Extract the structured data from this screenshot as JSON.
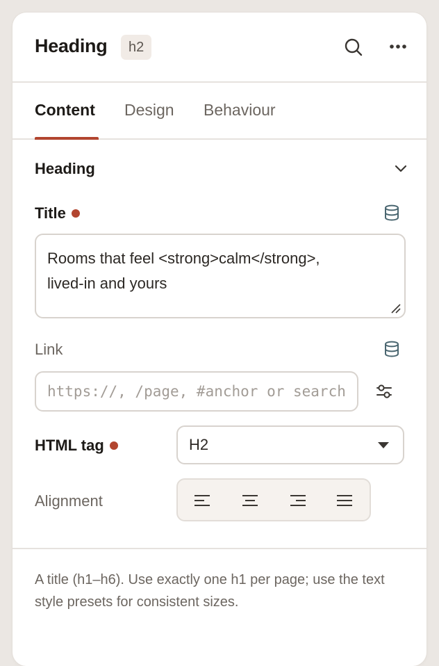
{
  "header": {
    "title": "Heading",
    "tag_badge": "h2",
    "search_icon": "search-icon",
    "more_icon": "more-horizontal-icon"
  },
  "tabs": [
    {
      "label": "Content",
      "active": true
    },
    {
      "label": "Design",
      "active": false
    },
    {
      "label": "Behaviour",
      "active": false
    }
  ],
  "section": {
    "title": "Heading",
    "collapse_icon": "chevron-down-icon"
  },
  "fields": {
    "title": {
      "label": "Title",
      "required": true,
      "value": "Rooms that feel <strong>calm</strong>,\nlived-in and yours",
      "dynamic_icon": "database-icon"
    },
    "link": {
      "label": "Link",
      "placeholder": "https://, /page, #anchor or search",
      "value": "",
      "dynamic_icon": "database-icon",
      "options_icon": "sliders-icon"
    },
    "html_tag": {
      "label": "HTML tag",
      "required": true,
      "value": "H2"
    },
    "alignment": {
      "label": "Alignment",
      "options": [
        "align-left-icon",
        "align-center-icon",
        "align-right-icon",
        "align-justify-icon"
      ]
    }
  },
  "help_text": "A title (h1–h6). Use exactly one h1 per page; use the text style presets for consistent sizes.",
  "colors": {
    "accent": "#b2452f",
    "muted_text": "#6c6660",
    "border": "#d8d3ce"
  }
}
